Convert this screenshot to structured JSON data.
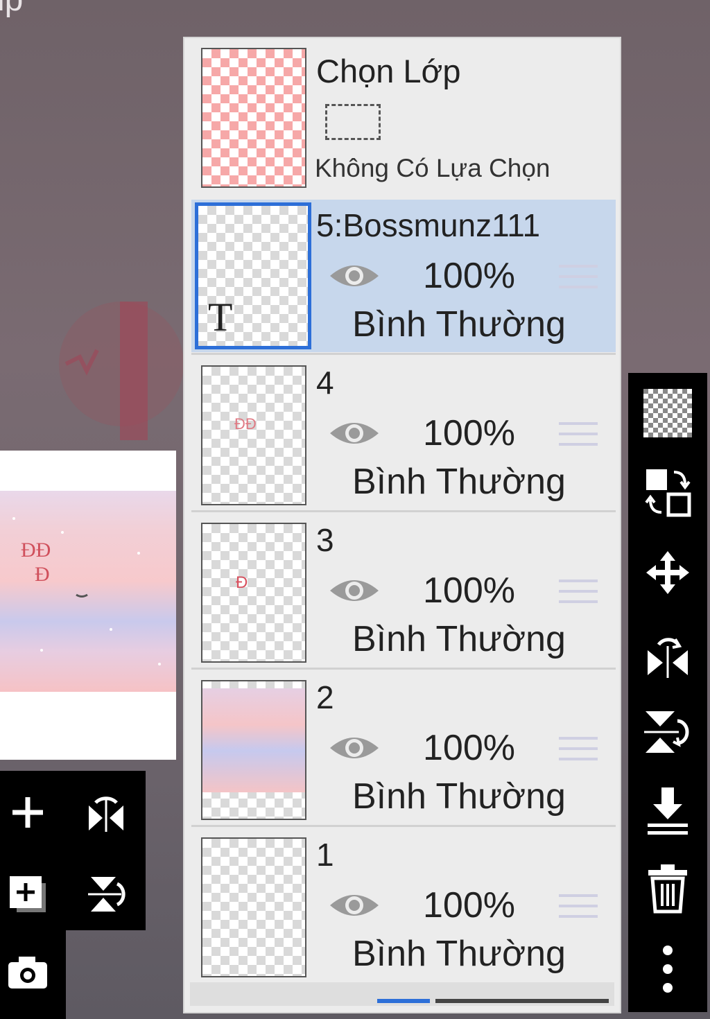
{
  "app": {
    "corner_text": "ip"
  },
  "selection_layer": {
    "title": "Chọn Lớp",
    "status": "Không Có Lựa Chọn"
  },
  "layers": [
    {
      "name": "5:Bossmunz111",
      "opacity": "100%",
      "blend": "Bình Thường",
      "selected": true,
      "type": "text"
    },
    {
      "name": "4",
      "opacity": "100%",
      "blend": "Bình Thường",
      "selected": false
    },
    {
      "name": "3",
      "opacity": "100%",
      "blend": "Bình Thường",
      "selected": false
    },
    {
      "name": "2",
      "opacity": "100%",
      "blend": "Bình Thường",
      "selected": false
    },
    {
      "name": "1",
      "opacity": "100%",
      "blend": "Bình Thường",
      "selected": false
    }
  ],
  "left_toolbar": {
    "buttons": [
      "add-layer-icon",
      "flip-horizontal-icon",
      "add-layer-copy-icon",
      "flip-vertical-icon",
      "camera-icon"
    ]
  },
  "right_toolbar": {
    "buttons": [
      "transparency-icon",
      "swap-layer-icon",
      "move-icon",
      "flip-horizontal-rotate-icon",
      "flip-vertical-rotate-icon",
      "merge-down-icon",
      "trash-icon",
      "more-options-icon"
    ]
  },
  "colors": {
    "selected_row": "#c7d7ec",
    "selected_border": "#2d6fd8",
    "panel_bg": "#ececec"
  },
  "text_badge": "T"
}
